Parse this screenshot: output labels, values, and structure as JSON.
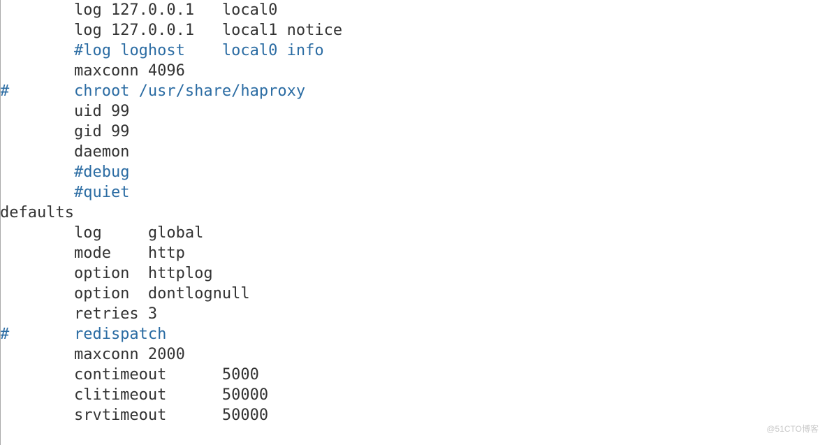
{
  "lines": [
    {
      "indent": "        ",
      "text": "log 127.0.0.1   local0",
      "comment": false
    },
    {
      "indent": "        ",
      "text": "log 127.0.0.1   local1 notice",
      "comment": false
    },
    {
      "indent": "        ",
      "text": "#log loghost    local0 info",
      "comment": true
    },
    {
      "indent": "        ",
      "text": "maxconn 4096",
      "comment": false
    },
    {
      "indent": "",
      "text": "#       chroot /usr/share/haproxy",
      "comment": true
    },
    {
      "indent": "        ",
      "text": "uid 99",
      "comment": false
    },
    {
      "indent": "        ",
      "text": "gid 99",
      "comment": false
    },
    {
      "indent": "        ",
      "text": "daemon",
      "comment": false
    },
    {
      "indent": "        ",
      "text": "#debug",
      "comment": true
    },
    {
      "indent": "        ",
      "text": "#quiet",
      "comment": true
    },
    {
      "indent": "",
      "text": "",
      "comment": false
    },
    {
      "indent": "",
      "text": "defaults",
      "comment": false
    },
    {
      "indent": "        ",
      "text": "log     global",
      "comment": false
    },
    {
      "indent": "        ",
      "text": "mode    http",
      "comment": false
    },
    {
      "indent": "        ",
      "text": "option  httplog",
      "comment": false
    },
    {
      "indent": "        ",
      "text": "option  dontlognull",
      "comment": false
    },
    {
      "indent": "        ",
      "text": "retries 3",
      "comment": false
    },
    {
      "indent": "",
      "text": "#       redispatch",
      "comment": true
    },
    {
      "indent": "        ",
      "text": "maxconn 2000",
      "comment": false
    },
    {
      "indent": "        ",
      "text": "contimeout      5000",
      "comment": false
    },
    {
      "indent": "        ",
      "text": "clitimeout      50000",
      "comment": false
    },
    {
      "indent": "        ",
      "text": "srvtimeout      50000",
      "comment": false
    }
  ],
  "watermark": "@51CTO博客"
}
